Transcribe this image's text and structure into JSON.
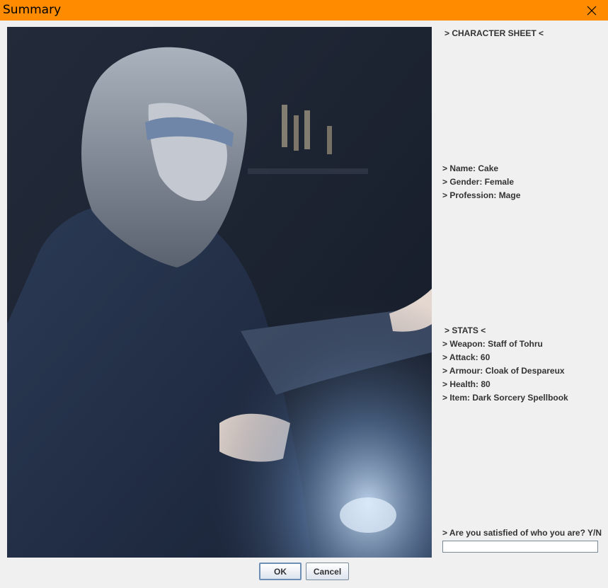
{
  "window": {
    "title": "Summary",
    "accent_color": "#ff8c00",
    "close_icon": "close-icon"
  },
  "sheet": {
    "heading": "> CHARACTER SHEET <",
    "name": "> Name: Cake",
    "gender": "> Gender: Female",
    "profession": "> Profession: Mage"
  },
  "stats": {
    "heading": "> STATS <",
    "weapon": "> Weapon: Staff of Tohru",
    "attack": "> Attack: 60",
    "armour": "> Armour: Cloak of Despareux",
    "health": "> Health: 80",
    "item": "> Item: Dark Sorcery Spellbook"
  },
  "prompt": {
    "question": "> Are you satisfied of who you are? Y/N",
    "answer_value": ""
  },
  "buttons": {
    "ok_label": "OK",
    "cancel_label": "Cancel"
  }
}
